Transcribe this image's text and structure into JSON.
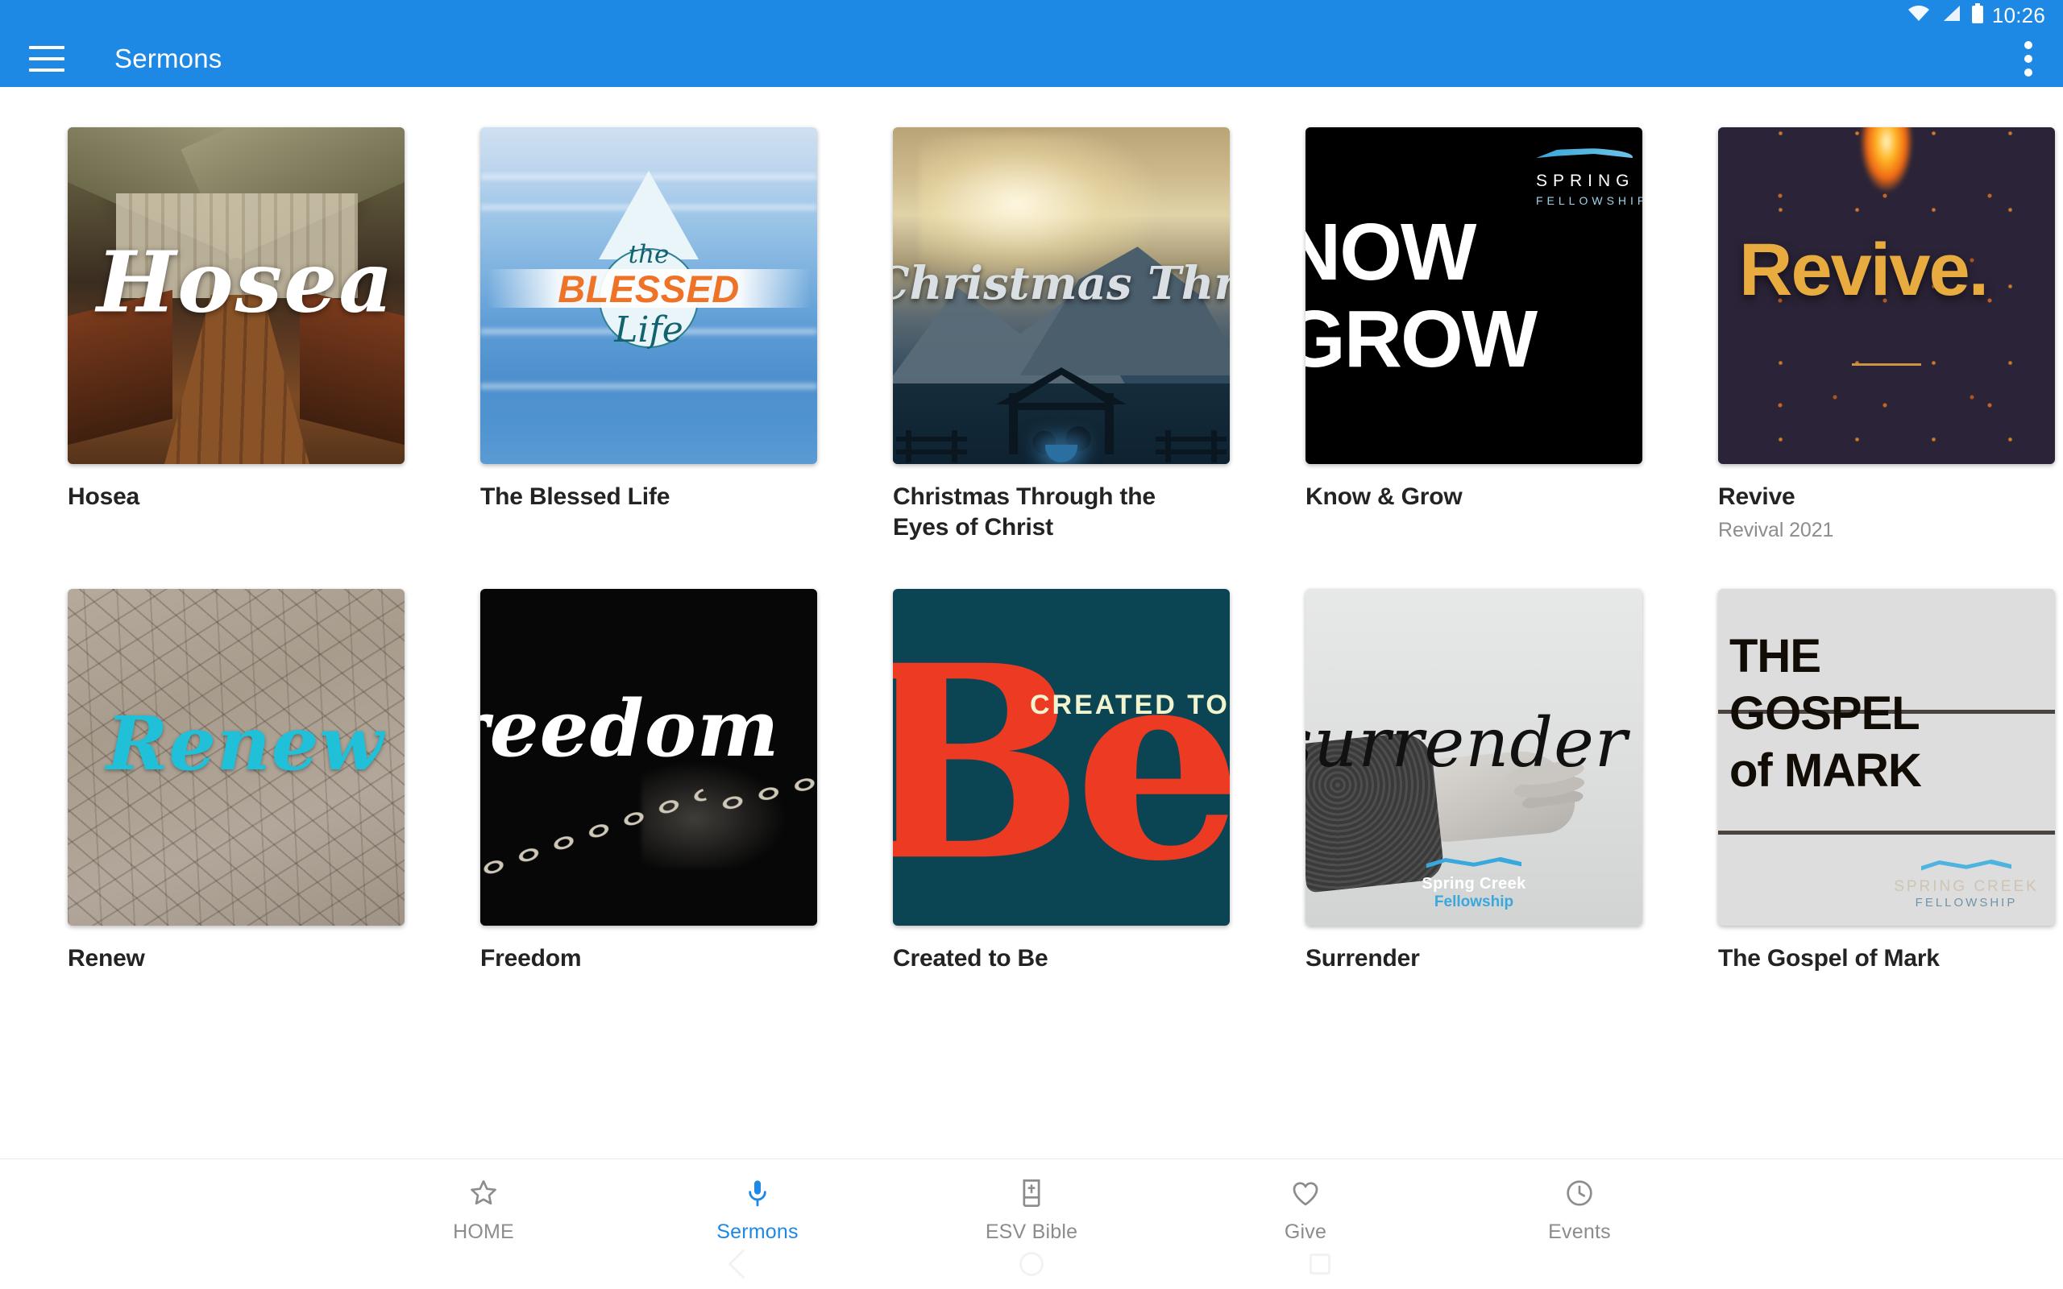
{
  "status_bar": {
    "time": "10:26",
    "icons": [
      "wifi-icon",
      "cellular-signal-icon",
      "battery-icon"
    ]
  },
  "app_bar": {
    "title": "Sermons",
    "menu_icon": "hamburger-menu-icon",
    "overflow_icon": "overflow-menu-icon",
    "background_color": "#1e88e5"
  },
  "sermons": [
    {
      "title": "Hosea",
      "subtitle": "",
      "artwork_text": "Hosea",
      "artwork_desc": "rustic-chapel-interior"
    },
    {
      "title": "The Blessed Life",
      "subtitle": "",
      "artwork_text": "the BLESSED Life",
      "artwork_desc": "water-droplet-on-blue-water",
      "artwork_parts": {
        "the": "the",
        "blessed": "BLESSED",
        "life": "Life"
      }
    },
    {
      "title": "Christmas Through the Eyes of Christ",
      "subtitle": "",
      "artwork_text": "Christmas Through the Eyes of Christ",
      "artwork_desc": "nativity-silhouette-starry-sky"
    },
    {
      "title": "Know & Grow",
      "subtitle": "",
      "artwork_text": "KNOW GROW",
      "artwork_desc": "black-background-bold-type",
      "artwork_parts": {
        "line1": "NOW",
        "line2": "GROW"
      },
      "logo": {
        "name": "SPRING",
        "sub": "FELLOWSHIP"
      }
    },
    {
      "title": "Revive",
      "subtitle": "Revival 2021",
      "artwork_text": "Revive.",
      "artwork_desc": "fire-sparks-dark-purple"
    },
    {
      "title": "Renew",
      "subtitle": "",
      "artwork_text": "Renew",
      "artwork_desc": "cracked-dry-earth"
    },
    {
      "title": "Freedom",
      "subtitle": "",
      "artwork_text": "reedom",
      "artwork_desc": "breaking-chain-on-black"
    },
    {
      "title": "Created to Be",
      "subtitle": "",
      "artwork_text": "CREATED TO Be",
      "artwork_desc": "teal-background-red-be",
      "artwork_parts": {
        "kicker": "CREATED TO",
        "big": "Be"
      }
    },
    {
      "title": "Surrender",
      "subtitle": "",
      "artwork_text": "surrender",
      "artwork_desc": "black-and-white-open-hand",
      "logo": {
        "name": "Spring Creek",
        "sub": "Fellowship"
      }
    },
    {
      "title": "The Gospel of Mark",
      "subtitle": "",
      "artwork_text": "THE GOSPEL of MARK",
      "artwork_desc": "rustic-wood-planks",
      "artwork_parts": {
        "line1": "THE",
        "line2": "GOSPEL",
        "line3": "of MARK"
      },
      "logo": {
        "name": "SPRING CREEK",
        "sub": "FELLOWSHIP"
      }
    }
  ],
  "bottom_nav": {
    "active_color": "#1e88e5",
    "items": [
      {
        "label": "HOME",
        "icon": "star-icon",
        "active": false
      },
      {
        "label": "Sermons",
        "icon": "microphone-icon",
        "active": true
      },
      {
        "label": "ESV Bible",
        "icon": "bible-book-icon",
        "active": false
      },
      {
        "label": "Give",
        "icon": "heart-icon",
        "active": false
      },
      {
        "label": "Events",
        "icon": "clock-icon",
        "active": false
      }
    ]
  },
  "system_nav": {
    "back": "back-icon",
    "home": "home-icon",
    "recents": "recents-icon"
  }
}
